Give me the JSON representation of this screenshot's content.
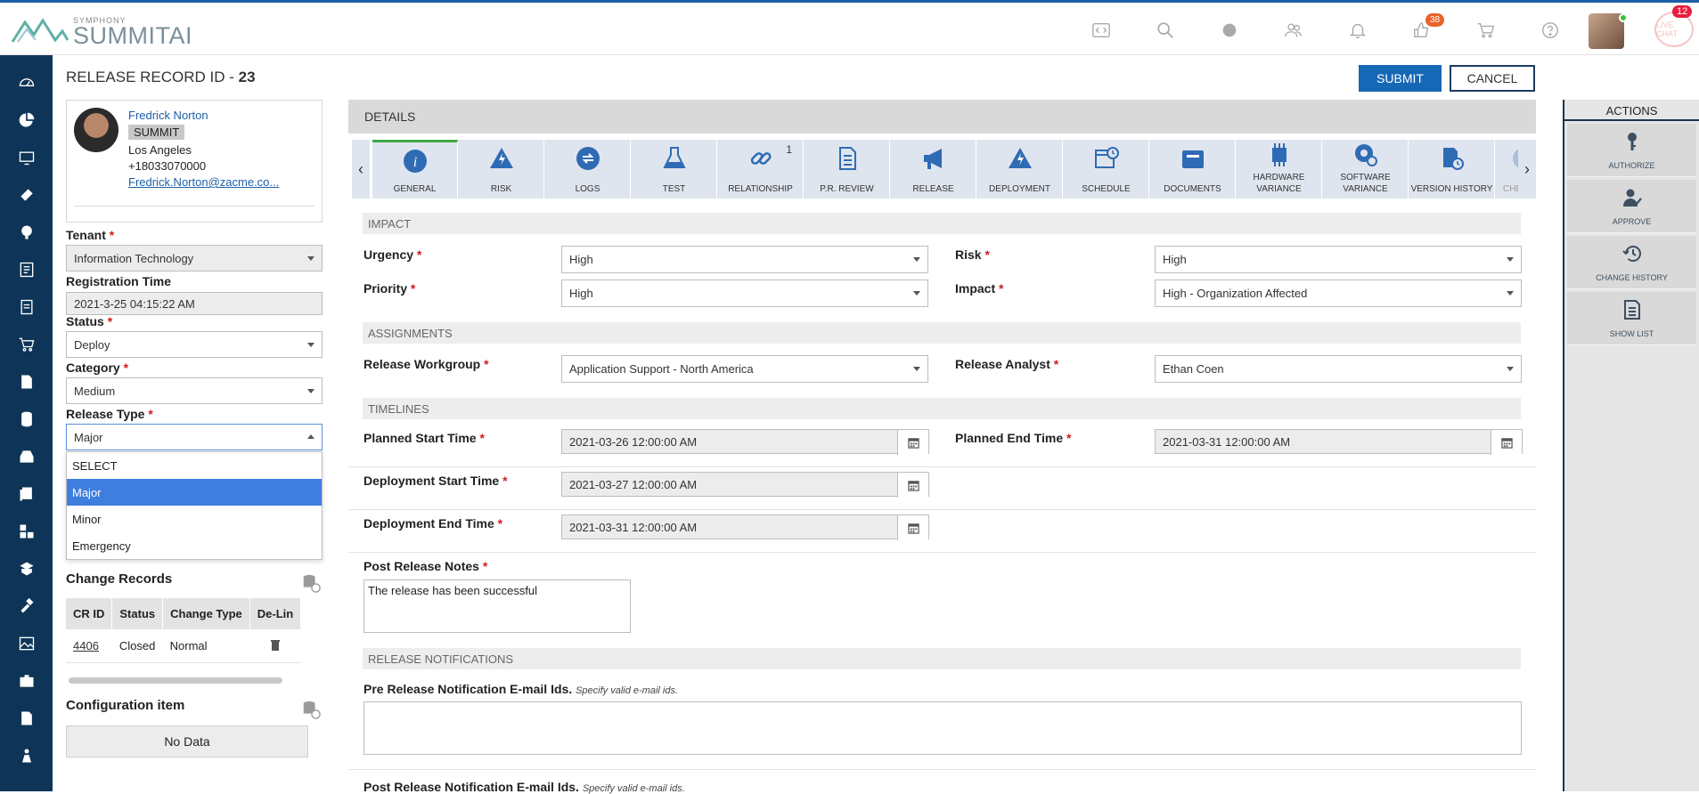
{
  "header": {
    "logo_small": "SYMPHONY",
    "logo_big": "SUMMITAI",
    "notifications_count": "38",
    "chat_label": "LIVE CHAT",
    "chat_count": "12"
  },
  "page": {
    "title_prefix": "RELEASE RECORD ID - ",
    "record_id": "23",
    "submit_label": "SUBMIT",
    "cancel_label": "CANCEL"
  },
  "requester": {
    "name": "Fredrick Norton",
    "tag": "SUMMIT",
    "city": "Los Angeles",
    "phone": "+18033070000",
    "email": "Fredrick.Norton@zacme.co..."
  },
  "left_form": {
    "tenant_label": "Tenant",
    "tenant_value": "Information Technology",
    "registration_label": "Registration Time",
    "registration_value": "2021-3-25 04:15:22 AM",
    "status_label": "Status",
    "status_value": "Deploy",
    "category_label": "Category",
    "category_value": "Medium",
    "release_type_label": "Release Type",
    "release_type_value": "Major",
    "release_type_options": [
      "SELECT",
      "Major",
      "Minor",
      "Emergency"
    ]
  },
  "change_records": {
    "title": "Change Records",
    "columns": [
      "CR ID",
      "Status",
      "Change Type",
      "De-Lin"
    ],
    "rows": [
      {
        "id": "4406",
        "status": "Closed",
        "type": "Normal"
      }
    ]
  },
  "config_item": {
    "title": "Configuration item",
    "empty": "No Data"
  },
  "details": {
    "header": "DETAILS",
    "tabs": [
      {
        "label": "GENERAL",
        "icon": "info-icon"
      },
      {
        "label": "RISK",
        "icon": "warning-icon"
      },
      {
        "label": "LOGS",
        "icon": "logs-icon"
      },
      {
        "label": "TEST",
        "icon": "flask-icon"
      },
      {
        "label": "RELATIONSHIP",
        "icon": "link-icon",
        "count": "1"
      },
      {
        "label": "P.R. REVIEW",
        "icon": "document-icon"
      },
      {
        "label": "RELEASE",
        "icon": "megaphone-icon"
      },
      {
        "label": "DEPLOYMENT",
        "icon": "warning-icon"
      },
      {
        "label": "SCHEDULE",
        "icon": "calendar-clock-icon"
      },
      {
        "label": "DOCUMENTS",
        "icon": "folder-icon"
      },
      {
        "label": "HARDWARE VARIANCE",
        "icon": "chip-icon"
      },
      {
        "label": "SOFTWARE VARIANCE",
        "icon": "gear-icon"
      },
      {
        "label": "VERSION HISTORY",
        "icon": "history-doc-icon"
      },
      {
        "label": "CHECKL",
        "icon": "checklist-icon"
      }
    ],
    "impact": {
      "title": "IMPACT",
      "urgency_label": "Urgency",
      "urgency_value": "High",
      "risk_label": "Risk",
      "risk_value": "High",
      "priority_label": "Priority",
      "priority_value": "High",
      "impact_label": "Impact",
      "impact_value": "High - Organization Affected"
    },
    "assignments": {
      "title": "ASSIGNMENTS",
      "workgroup_label": "Release Workgroup",
      "workgroup_value": "Application Support - North America",
      "analyst_label": "Release Analyst",
      "analyst_value": "Ethan Coen"
    },
    "timelines": {
      "title": "TIMELINES",
      "planned_start_label": "Planned Start Time",
      "planned_start_value": "2021-03-26 12:00:00 AM",
      "planned_end_label": "Planned End Time",
      "planned_end_value": "2021-03-31 12:00:00 AM",
      "deploy_start_label": "Deployment Start Time",
      "deploy_start_value": "2021-03-27 12:00:00 AM",
      "deploy_end_label": "Deployment End Time",
      "deploy_end_value": "2021-03-31 12:00:00 AM"
    },
    "notes": {
      "label": "Post Release Notes",
      "value": "The release has been successful"
    },
    "notifications": {
      "title": "RELEASE NOTIFICATIONS",
      "pre_label": "Pre Release Notification E-mail Ids.",
      "pre_hint": "Specify valid e-mail ids.",
      "post_label": "Post Release Notification E-mail Ids.",
      "post_hint": "Specify valid e-mail ids."
    }
  },
  "actions": {
    "title": "ACTIONS",
    "items": [
      {
        "label": "AUTHORIZE",
        "icon": "key-icon"
      },
      {
        "label": "APPROVE",
        "icon": "user-check-icon"
      },
      {
        "label": "CHANGE HISTORY",
        "icon": "history-icon"
      },
      {
        "label": "SHOW LIST",
        "icon": "list-doc-icon"
      }
    ]
  }
}
